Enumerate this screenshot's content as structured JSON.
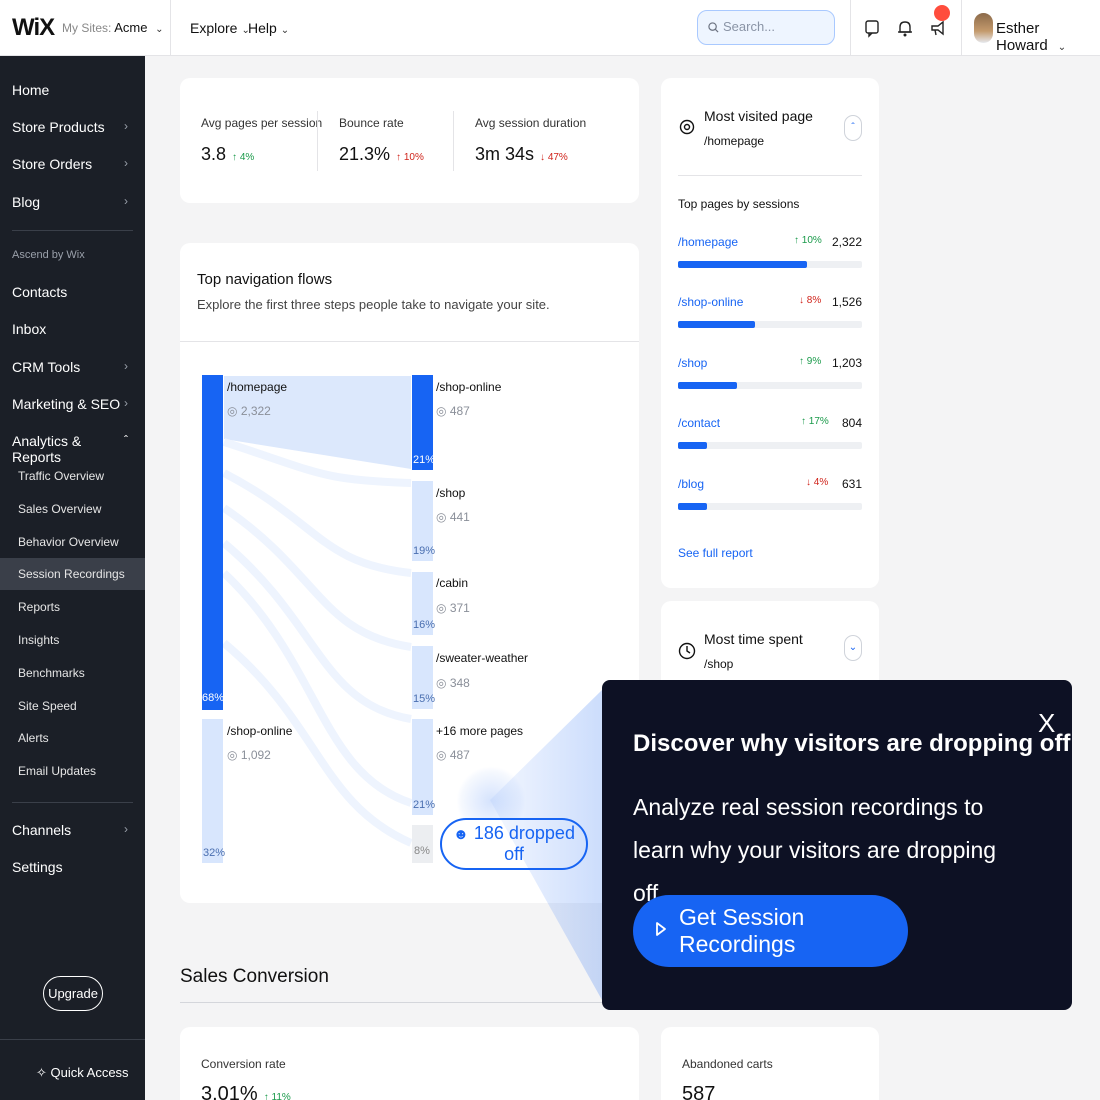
{
  "topbar": {
    "logo": "WiX",
    "site_prefix": "My Sites:",
    "site_name": "Acme",
    "nav": [
      "Explore",
      "Help"
    ],
    "search_placeholder": "Search...",
    "user_name": "Esther Howard"
  },
  "sidebar": {
    "items_top": [
      "Home",
      "Store Products",
      "Store Orders",
      "Blog"
    ],
    "group_label": "Ascend by Wix",
    "items_mid": [
      "Contacts",
      "Inbox",
      "CRM Tools",
      "Marketing & SEO",
      "Analytics & Reports"
    ],
    "analytics_sub": [
      "Traffic Overview",
      "Sales Overview",
      "Behavior Overview",
      "Session Recordings",
      "Reports",
      "Insights",
      "Benchmarks",
      "Site Speed",
      "Alerts",
      "Email Updates"
    ],
    "active_sub": "Session Recordings",
    "items_bottom": [
      "Channels",
      "Settings"
    ],
    "upgrade": "Upgrade",
    "quick_access": "Quick Access"
  },
  "metrics": [
    {
      "label": "Avg pages per session",
      "value": "3.8",
      "trend": "4%",
      "dir": "up"
    },
    {
      "label": "Bounce rate",
      "value": "21.3%",
      "trend": "10%",
      "dir": "up-red"
    },
    {
      "label": "Avg session duration",
      "value": "3m 34s",
      "trend": "47%",
      "dir": "down"
    }
  ],
  "flows": {
    "title": "Top navigation flows",
    "subtitle": "Explore the first three steps people take to navigate your site.",
    "step1": [
      {
        "label": "/homepage",
        "count": "2,322",
        "pct": "68%",
        "share": 0.68
      },
      {
        "label": "/shop-online",
        "count": "1,092",
        "pct": "32%",
        "share": 0.32
      }
    ],
    "step2": [
      {
        "label": "/shop-online",
        "count": "487",
        "pct": "21%"
      },
      {
        "label": "/shop",
        "count": "441",
        "pct": "19%"
      },
      {
        "label": "/cabin",
        "count": "371",
        "pct": "16%"
      },
      {
        "label": "/sweater-weather",
        "count": "348",
        "pct": "15%"
      },
      {
        "label": "+16 more pages",
        "count": "487",
        "pct": "21%"
      },
      {
        "label": "",
        "count": "",
        "pct": "8%"
      }
    ],
    "dropped": "186 dropped off"
  },
  "most_visited": {
    "title": "Most visited page",
    "page": "/homepage",
    "list_title": "Top pages by sessions",
    "pages": [
      {
        "path": "/homepage",
        "trend": "10%",
        "dir": "up",
        "value": "2,322",
        "share": 0.7
      },
      {
        "path": "/shop-online",
        "trend": "8%",
        "dir": "down",
        "value": "1,526",
        "share": 0.42
      },
      {
        "path": "/shop",
        "trend": "9%",
        "dir": "up",
        "value": "1,203",
        "share": 0.32
      },
      {
        "path": "/contact",
        "trend": "17%",
        "dir": "up",
        "value": "804",
        "share": 0.16
      },
      {
        "path": "/blog",
        "trend": "4%",
        "dir": "down",
        "value": "631",
        "share": 0.16
      }
    ],
    "see_full": "See full report"
  },
  "most_time": {
    "title": "Most time spent",
    "page": "/shop"
  },
  "sales": {
    "section_title": "Sales Conversion",
    "conversion_label": "Conversion rate",
    "conversion_value": "3.01%",
    "conversion_trend": "11%",
    "abandoned_label": "Abandoned carts",
    "abandoned_value": "587"
  },
  "popover": {
    "title": "Discover why visitors are dropping off",
    "body": "Analyze real session recordings to learn why your visitors are dropping off.",
    "cta": "Get Session Recordings",
    "close": "X"
  },
  "colors": {
    "accent": "#1764f3",
    "sidebar": "#1b1f27",
    "popover": "#0d1124",
    "up": "#1a9a4a",
    "down": "#d0241b"
  }
}
